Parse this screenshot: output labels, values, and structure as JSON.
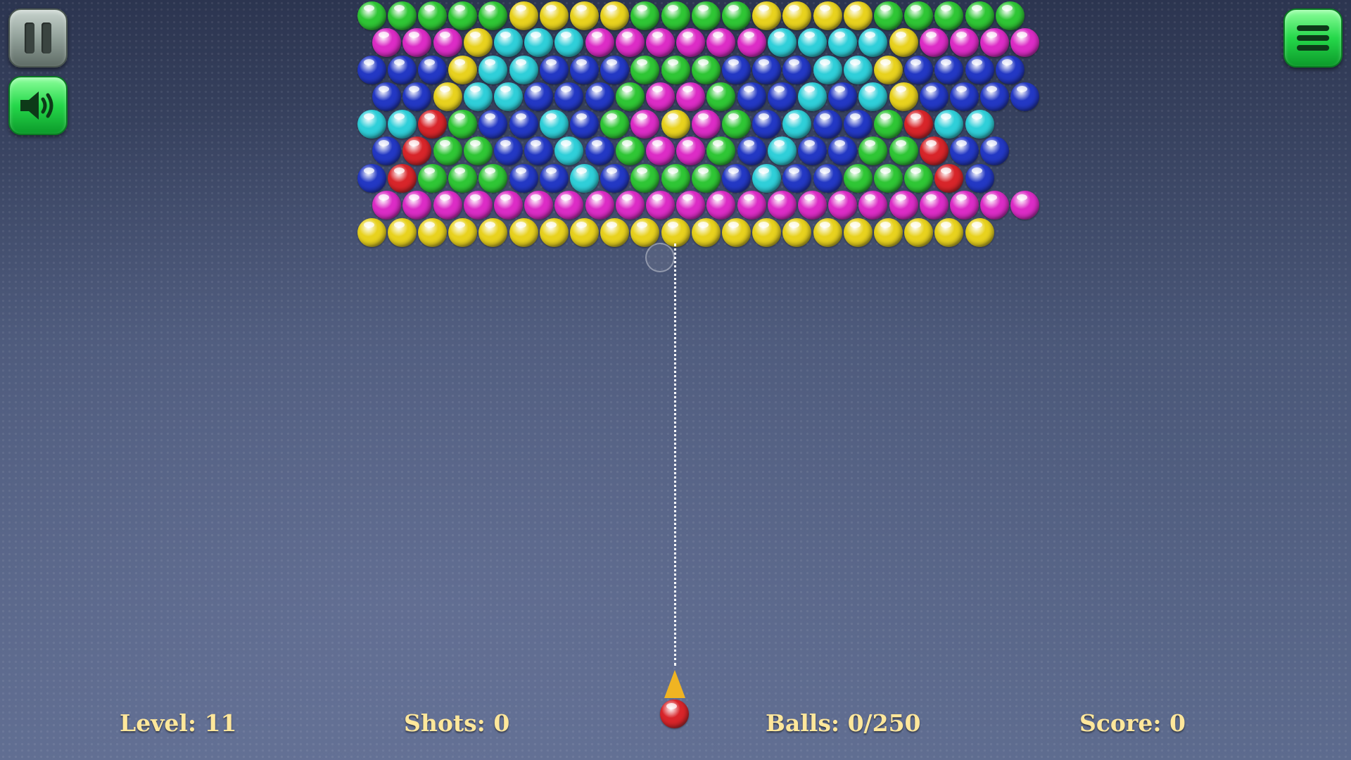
{
  "controls": {
    "pause": {
      "icon": "pause-icon"
    },
    "sound": {
      "icon": "speaker-icon"
    },
    "menu": {
      "icon": "hamburger-menu-icon"
    }
  },
  "colors": {
    "g": "#2fc635",
    "y": "#e8d21e",
    "m": "#dc2cc6",
    "c": "#2fcfd9",
    "b": "#2338c4",
    "r": "#d8252a"
  },
  "bubble_grid": [
    "gggggyyyyggggyyyyggggg",
    "mmmycccmmmmmmccccymmmm",
    "bbbyccbbbgggbbbccybbbb",
    "bbyccbbbgmmgbbcbcybbbb",
    "ccrgbbcbgmymgbcbbgrcc",
    "brggbbcbgmmgbcbbggrbb",
    "brgggbbcbgggbcbbgggrb",
    "mmmmmmmmmmmmmmmmmmmmmm",
    "yyyyyyyyyyyyyyyyyyyyy"
  ],
  "shooter": {
    "current_ball": "r"
  },
  "hud": {
    "level": "Level: 11",
    "shots": "Shots: 0",
    "balls": "Balls: 0/250",
    "score": "Score: 0"
  }
}
